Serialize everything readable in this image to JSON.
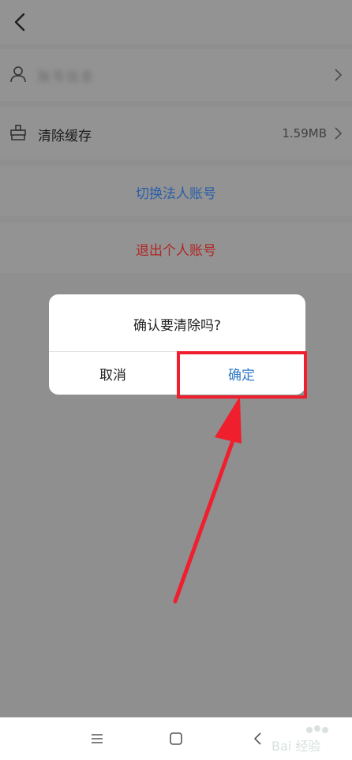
{
  "top_bar": {
    "back_icon": "chevron-left-icon"
  },
  "settings": {
    "user_row": {
      "icon": "user-icon",
      "label": "账号信息",
      "chevron": "chevron-right-icon"
    },
    "cache_row": {
      "icon": "broom-icon",
      "label": "清除缓存",
      "value": "1.59MB",
      "chevron": "chevron-right-icon"
    },
    "switch_account_label": "切换法人账号",
    "logout_label": "退出个人账号"
  },
  "dialog": {
    "message": "确认要清除吗?",
    "cancel_label": "取消",
    "confirm_label": "确定"
  },
  "colors": {
    "overlay_bg": "#8f8f8f",
    "switch_text": "#2a5fa8",
    "logout_text": "#b02524",
    "confirm_text": "#2f78c4",
    "annotation_red": "#ef1f2e"
  },
  "nav_bar": {
    "menu_icon": "menu-icon",
    "home_icon": "square-home-icon",
    "back_icon": "back-triangle-icon"
  },
  "watermark": {
    "text": "Bai 经验"
  }
}
